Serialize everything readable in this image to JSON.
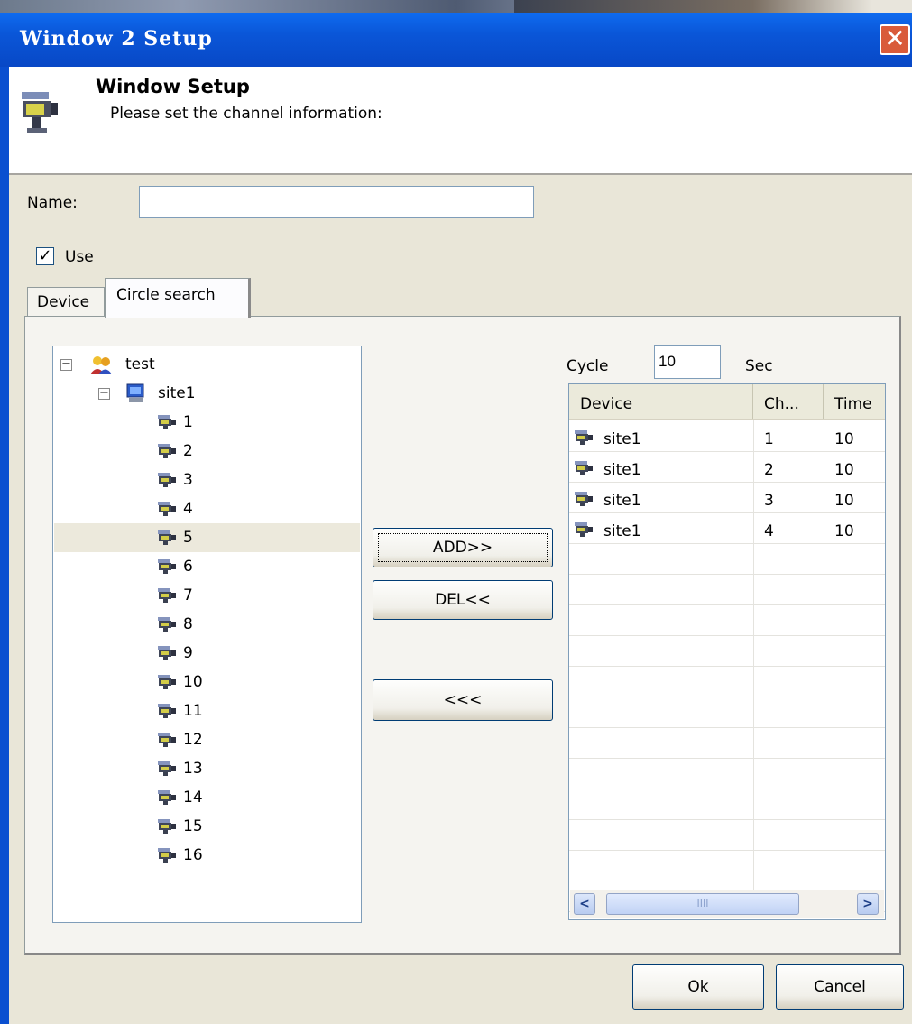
{
  "window": {
    "title": "Window 2 Setup",
    "close_glyph": "✕"
  },
  "header": {
    "title": "Window Setup",
    "subtitle": "Please set the channel information:",
    "icon": "camera-icon"
  },
  "form": {
    "name_label": "Name:",
    "name_value": "",
    "use_label": "Use",
    "use_checked": true,
    "use_check_glyph": "✓"
  },
  "tabs": [
    {
      "label": "Device",
      "active": false
    },
    {
      "label": "Circle search",
      "active": true
    }
  ],
  "tree": {
    "root": {
      "label": "test",
      "expander": "−",
      "icon": "group-icon"
    },
    "site": {
      "label": "site1",
      "expander": "−",
      "icon": "computer-icon"
    },
    "channels": [
      "1",
      "2",
      "3",
      "4",
      "5",
      "6",
      "7",
      "8",
      "9",
      "10",
      "11",
      "12",
      "13",
      "14",
      "15",
      "16"
    ],
    "selected_channel": "5"
  },
  "buttons": {
    "add": "ADD>>",
    "del": "DEL<<",
    "back": "<<<",
    "ok": "Ok",
    "cancel": "Cancel"
  },
  "cycle": {
    "label": "Cycle",
    "value": "10",
    "unit": "Sec"
  },
  "list": {
    "columns": [
      "Device",
      "Ch...",
      "Time"
    ],
    "rows": [
      {
        "device": "site1",
        "channel": "1",
        "time": "10"
      },
      {
        "device": "site1",
        "channel": "2",
        "time": "10"
      },
      {
        "device": "site1",
        "channel": "3",
        "time": "10"
      },
      {
        "device": "site1",
        "channel": "4",
        "time": "10"
      }
    ],
    "scroll_left": "<",
    "scroll_right": ">",
    "scroll_grip": "IIII"
  },
  "colors": {
    "titlebar": "#0a56d8",
    "face": "#e9e6d8",
    "close": "#d95b3a"
  }
}
